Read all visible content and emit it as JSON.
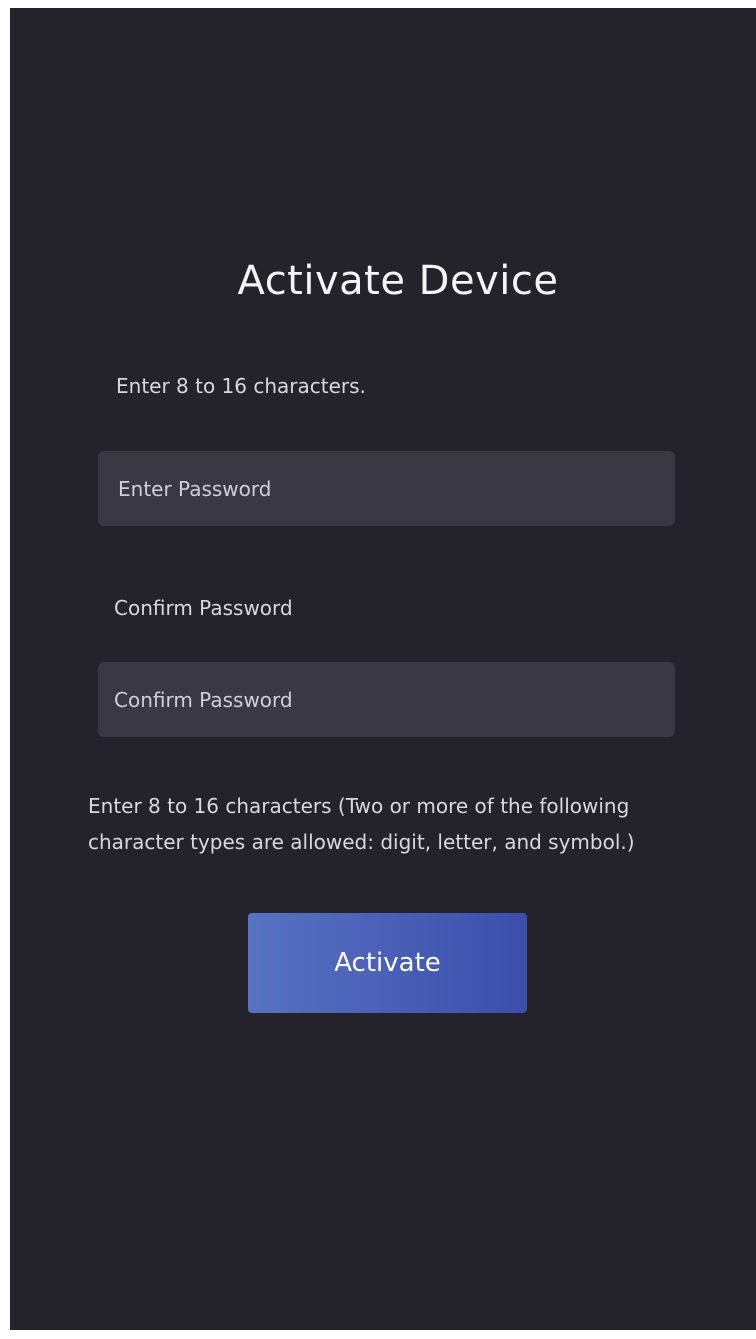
{
  "title": "Activate Device",
  "password_hint": "Enter 8 to 16 characters.",
  "password_field": {
    "placeholder": "Enter Password",
    "value": ""
  },
  "confirm_label": "Confirm Password",
  "confirm_field": {
    "placeholder": "Confirm Password",
    "value": ""
  },
  "rules_text": "Enter 8 to 16 characters (Two or more of the following character types are allowed: digit, letter, and symbol.)",
  "activate_button": {
    "label": "Activate"
  },
  "colors": {
    "background": "#24232b",
    "field": "#393843",
    "button_start": "#5872c2",
    "button_end": "#3b4eab"
  }
}
